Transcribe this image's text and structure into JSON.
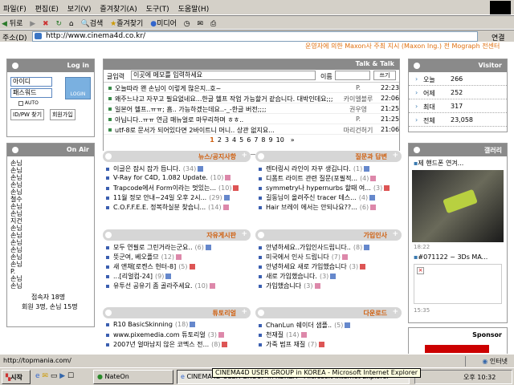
{
  "menubar": {
    "items": [
      "파일(F)",
      "편집(E)",
      "보기(V)",
      "즐겨찾기(A)",
      "도구(T)",
      "도움말(H)"
    ]
  },
  "toolbar": {
    "back": "뒤로",
    "search": "검색",
    "favorites": "즐겨찾기",
    "media": "미디어"
  },
  "address": {
    "label": "주소(D)",
    "url": "http://www.cinema4d.co.kr/",
    "go": "연결"
  },
  "top_strip": "운영자에 의한 Maxon사 주최 지시 (Maxon Ing.) 전 Mograph 전센터",
  "login": {
    "title": "Log in",
    "id_placeholder": "아이디",
    "pw_placeholder": "패스워드",
    "login_btn": "LOGIN",
    "auto": "AUTO",
    "find_btn": "ID/PW 찾기",
    "join_btn": "회원가입"
  },
  "onair": {
    "title": "On Air",
    "users": [
      "손님",
      "손님",
      "손님",
      "손님",
      "손님",
      "철수",
      "손님",
      "손님",
      "지건",
      "손님",
      "손님",
      "손님",
      "손님",
      "손님",
      "손님",
      "P.",
      "손님",
      "손님"
    ],
    "count_line1": "접속자 18명",
    "count_line2": "회원 3명, 손님 15명"
  },
  "talk": {
    "title": "Talk & Talk",
    "label": "글입력",
    "placeholder": "이곳에 메모를 입력하세요",
    "name_label": "이름",
    "name_value": "",
    "write_btn": "쓰기",
    "rows": [
      {
        "text": "오늘따라 왠 손님이 이렇게 많은지..호~",
        "name": "P.",
        "time": "22:23"
      },
      {
        "text": "왜주느냐고 자꾸고 필요없네요...한글 헬프 작업 가능할거 같습니다. 대박인데요;;;",
        "name": "카이엘블루",
        "time": "22:06"
      },
      {
        "text": "일본어 헬프..ㅠㅠ; 흠.. 가능하겠는데요..-_-한글 버전;;;;",
        "name": "권우영",
        "time": "21:25"
      },
      {
        "text": "아닙니다..ㅠㅠ 연금 매뉴얼로 마무리하며 ㅎㅎ..",
        "name": "P.",
        "time": "21:25"
      },
      {
        "text": "utf-8로 문서가 되어있다면 2바이트니 머니.. 상관 없지요...",
        "name": "마리건허기",
        "time": "21:06"
      }
    ],
    "pages": [
      "1",
      "2",
      "3",
      "4",
      "5",
      "6",
      "7",
      "8",
      "9",
      "10"
    ],
    "next": "»"
  },
  "visitor": {
    "title": "Visitor",
    "rows": [
      {
        "label": "오늘",
        "value": "266"
      },
      {
        "label": "어제",
        "value": "252"
      },
      {
        "label": "최대",
        "value": "317"
      },
      {
        "label": "전체",
        "value": "23,058"
      }
    ]
  },
  "gallery": {
    "title": "갤러리",
    "item1": "제 핸드폰 연겨...",
    "time1": "18:22",
    "item2": "#071122 ~ 3Ds MA...",
    "time2": "15:35"
  },
  "sponsor": {
    "title": "Sponsor"
  },
  "sections": {
    "news": {
      "title": "뉴스/공지사항",
      "items": [
        {
          "t": "이글은 잠시 잡가 듭니다.",
          "c": "(34)"
        },
        {
          "t": "V-Ray for C4D, 1.082 Update.",
          "c": "(10)"
        },
        {
          "t": "Trapcode에서 Form이라는 멋있는...",
          "c": "(10)"
        },
        {
          "t": "11월 정모 안내~24일 오후 2시...",
          "c": "(29)"
        },
        {
          "t": "C.O.F.F.E.E. 정복하실분 찾습니...",
          "c": "(14)"
        }
      ]
    },
    "qna": {
      "title": "질문과 답변",
      "items": [
        {
          "t": "렌더링시 라인이 자꾸 생깁니다.",
          "c": "(1)"
        },
        {
          "t": "디폼트 라이트 관련 질문(포필적...",
          "c": "(4)"
        },
        {
          "t": "symmetry나 hypernurbs 할때 여...",
          "c": "(3)"
        },
        {
          "t": "길동님이 올려주신 tracer 테스...",
          "c": "(4)"
        },
        {
          "t": "Hair 브레이 에서는 안되나요??...",
          "c": "(6)"
        }
      ]
    },
    "free": {
      "title": "자유게시판",
      "items": [
        {
          "t": "모두 연필로 그린거라는군요..",
          "c": "(6)"
        },
        {
          "t": "뜻군여, 베오플므",
          "c": "(12)"
        },
        {
          "t": "새 앤채[로켄스 헌터-8]",
          "c": "(5)"
        },
        {
          "t": "...[리얼컴-24]",
          "c": "(9)"
        },
        {
          "t": "유투선 공유기 좀 골라주세요.",
          "c": "(10)"
        }
      ]
    },
    "greet": {
      "title": "가입인사",
      "items": [
        {
          "t": "안녕하세요..가입인사드립니다..",
          "c": "(8)"
        },
        {
          "t": "미국에서 인사 드립니다",
          "c": "(7)"
        },
        {
          "t": "안녕하세요 새로 가입했습니다",
          "c": "(3)"
        },
        {
          "t": "새로 가입했습니다.",
          "c": "(3)"
        },
        {
          "t": "가입했습니다",
          "c": "(3)"
        }
      ]
    },
    "tutorial": {
      "title": "튜토리얼",
      "items": [
        {
          "t": "R10 BasicSkinning",
          "c": "(18)"
        },
        {
          "t": "www.pixemedia.com 튜토리얼",
          "c": "(3)"
        },
        {
          "t": "2007년 얼마남지 않은 코멕스 전...",
          "c": "(8)"
        }
      ]
    },
    "download": {
      "title": "다운로드",
      "items": [
        {
          "t": "ChanLun 쉐이더 샘플..",
          "c": "(5)"
        },
        {
          "t": "천재질",
          "c": "(14)"
        },
        {
          "t": "가죽 범프 재질",
          "c": "(7)"
        }
      ]
    }
  },
  "status": {
    "text": "http://topmania.com/",
    "zone": "인터넷"
  },
  "taskbar": {
    "start": "시작",
    "nateon": "NateOn",
    "cinema": "CINEMA4D USER GROUP in KOREA - Microsoft Internet Explorer",
    "clock": "오후 10:32"
  }
}
